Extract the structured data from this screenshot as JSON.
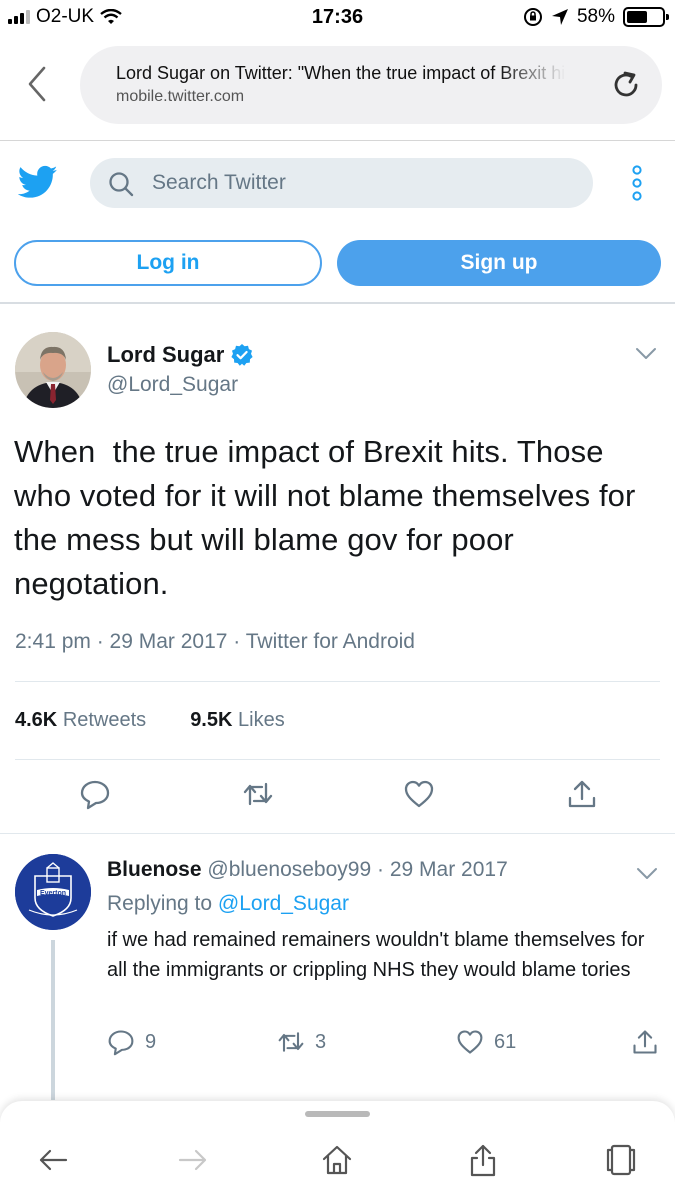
{
  "status_bar": {
    "carrier": "O2-UK",
    "time": "17:36",
    "battery_percent": "58%",
    "battery_level": 0.58
  },
  "browser": {
    "page_title": "Lord Sugar on Twitter: \"When the true impact of Brexit hits.",
    "domain": "mobile.twitter.com"
  },
  "twitter_header": {
    "search_placeholder": "Search Twitter",
    "login_label": "Log in",
    "signup_label": "Sign up",
    "brand_color": "#1da1f2"
  },
  "tweet": {
    "author_name": "Lord Sugar",
    "author_handle": "@Lord_Sugar",
    "verified": true,
    "text": "When  the true impact of Brexit hits. Those who voted for it will not blame themselves for the mess but will blame gov for poor negotation.",
    "meta": "2:41 pm · 29 Mar 2017 · Twitter for Android",
    "retweets_count": "4.6K",
    "retweets_label": "Retweets",
    "likes_count": "9.5K",
    "likes_label": "Likes"
  },
  "reply": {
    "author_name": "Bluenose",
    "author_handle": "@bluenoseboy99",
    "date_sep": "·",
    "date": "29 Mar 2017",
    "replying_prefix": "Replying to",
    "replying_to": "@Lord_Sugar",
    "avatar_text": "Everton",
    "text": "if we had remained remainers wouldn't blame themselves for all the immigrants or crippling NHS they would blame tories",
    "reply_count": "9",
    "retweet_count": "3",
    "like_count": "61"
  }
}
